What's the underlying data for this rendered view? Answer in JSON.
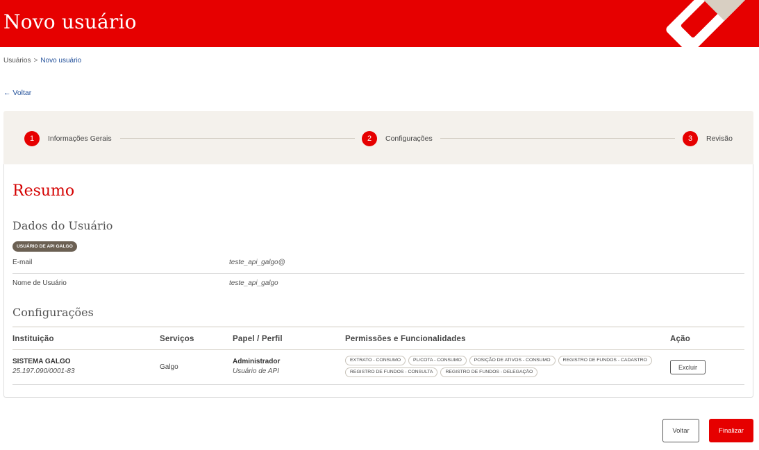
{
  "header": {
    "title": "Novo usuário"
  },
  "colors": {
    "brand_red": "#e60000",
    "badge_bg": "#6b6053",
    "stepper_bg": "#f4f1ec",
    "link_blue": "#1f4e99"
  },
  "breadcrumb": {
    "parent": "Usuários",
    "separator": ">",
    "current": "Novo usuário"
  },
  "back_link": "← Voltar",
  "stepper": {
    "steps": [
      {
        "number": "1",
        "label": "Informações Gerais"
      },
      {
        "number": "2",
        "label": "Configurações"
      },
      {
        "number": "3",
        "label": "Revisão"
      }
    ]
  },
  "summary": {
    "title": "Resumo",
    "user_section_title": "Dados do Usuário",
    "badge": "USUÁRIO DE API GALGO",
    "fields": [
      {
        "label": "E-mail",
        "value": "teste_api_galgo@"
      },
      {
        "label": "Nome de Usuário",
        "value": "teste_api_galgo"
      }
    ],
    "config_section_title": "Configurações"
  },
  "table": {
    "headers": {
      "instituicao": "Instituição",
      "servicos": "Serviços",
      "papel": "Papel / Perfil",
      "permissoes": "Permissões e Funcionalidades",
      "acao": "Ação"
    },
    "rows": [
      {
        "institution_name": "SISTEMA GALGO",
        "institution_cnpj": "25.197.090/0001-83",
        "service": "Galgo",
        "role": "Administrador",
        "profile": "Usuário de API",
        "permissions": [
          "EXTRATO - CONSUMO",
          "PL/COTA - CONSUMO",
          "POSIÇÃO DE ATIVOS - CONSUMO",
          "REGISTRO DE FUNDOS - CADASTRO",
          "REGISTRO DE FUNDOS - CONSULTA",
          "REGISTRO DE FUNDOS - DELEGAÇÃO"
        ],
        "action_label": "Excluir"
      }
    ]
  },
  "footer": {
    "back_label": "Voltar",
    "finish_label": "Finalizar"
  }
}
